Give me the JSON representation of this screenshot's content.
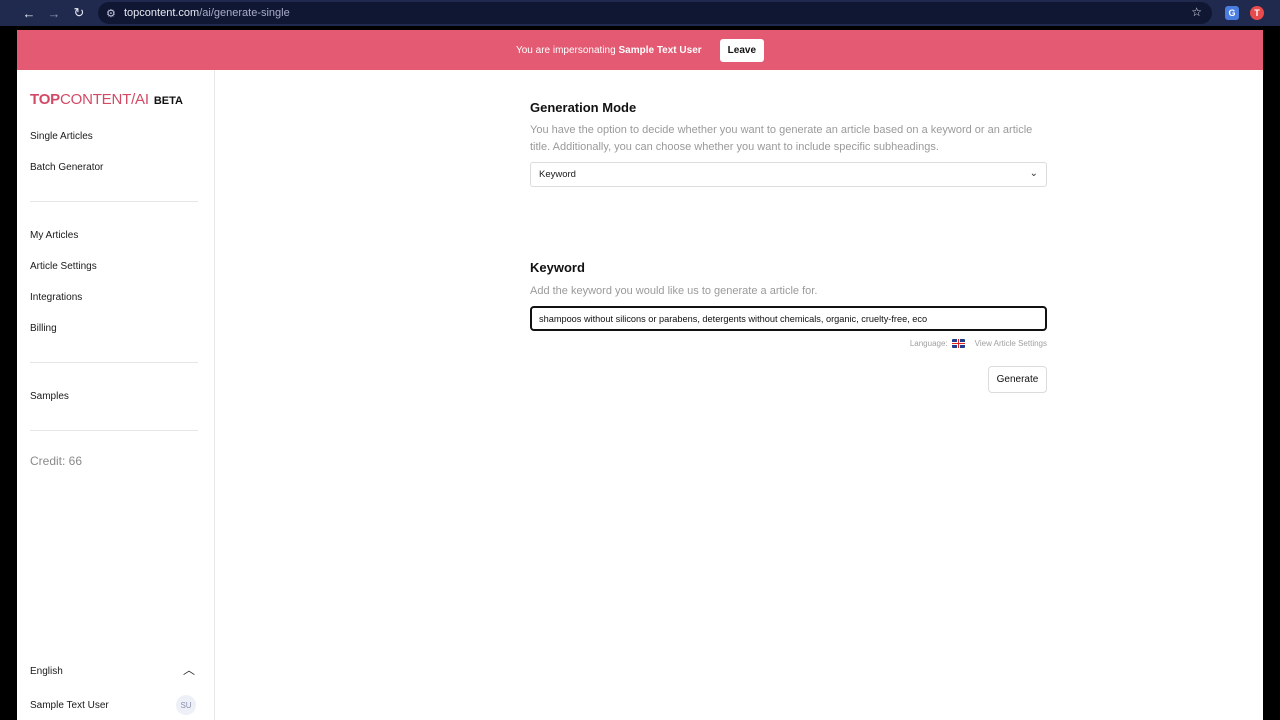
{
  "browser": {
    "url_host": "topcontent.com",
    "url_path": "/ai/generate-single",
    "back_icon": "←",
    "forward_icon": "→",
    "reload_icon": "↻"
  },
  "banner": {
    "prefix": "You are impersonating ",
    "user": "Sample Text User",
    "leave_label": "Leave",
    "color": "#e35a72"
  },
  "sidebar": {
    "logo_top": "TOP",
    "logo_content": "CONTENT/",
    "logo_ai": "AI",
    "beta": "BETA",
    "nav_primary": [
      "Single Articles",
      "Batch Generator"
    ],
    "nav_secondary": [
      "My Articles",
      "Article Settings",
      "Integrations",
      "Billing"
    ],
    "nav_tertiary": [
      "Samples"
    ],
    "credit": "Credit: 66",
    "language": "English",
    "user_name": "Sample Text User",
    "user_initials": "SU"
  },
  "main": {
    "mode_title": "Generation Mode",
    "mode_desc": "You have the option to decide whether you want to generate an article based on a keyword or an article title. Additionally, you can choose whether you want to include specific subheadings.",
    "mode_selected": "Keyword",
    "keyword_title": "Keyword",
    "keyword_desc": "Add the keyword you would like us to generate a article for.",
    "keyword_value": "shampoos without silicons or parabens, detergents without chemicals, organic, cruelty-free, eco",
    "language_label": "Language:",
    "view_settings_label": "View Article Settings",
    "generate_label": "Generate"
  }
}
